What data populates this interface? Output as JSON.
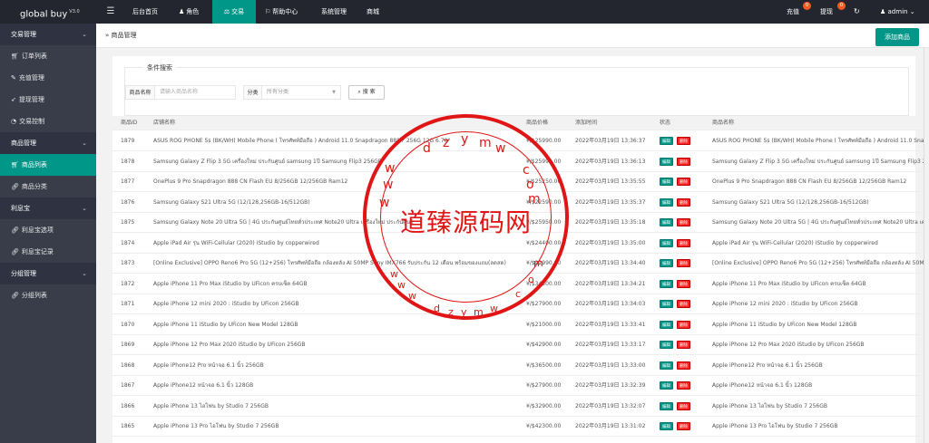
{
  "app": {
    "logo": "global buy",
    "version": "V3.0"
  },
  "topnav": {
    "items": [
      {
        "label": "后台首页",
        "icon": "home-icon"
      },
      {
        "label": "角色",
        "icon": "user-icon"
      },
      {
        "label": "交易",
        "icon": "scale-icon"
      },
      {
        "label": "帮助中心",
        "icon": "flag-icon"
      },
      {
        "label": "系统管理",
        "icon": ""
      },
      {
        "label": "商城",
        "icon": ""
      }
    ],
    "recharge_label": "充值",
    "recharge_count": "0",
    "withdraw_label": "提现",
    "withdraw_count": "0",
    "user": "admin"
  },
  "sidebar": {
    "groups": [
      {
        "label": "交易管理",
        "items": [
          {
            "label": "订单列表",
            "icon": "cart-icon"
          },
          {
            "label": "充值管理",
            "icon": "comment-icon"
          },
          {
            "label": "提现管理",
            "icon": "rocket-icon"
          },
          {
            "label": "交易控制",
            "icon": "dashboard-icon"
          }
        ]
      },
      {
        "label": "商品管理",
        "items": [
          {
            "label": "商品列表",
            "icon": "cart-icon"
          },
          {
            "label": "商品分类",
            "icon": "link-icon"
          }
        ]
      },
      {
        "label": "利息宝",
        "items": [
          {
            "label": "利息宝选项",
            "icon": "link-icon"
          },
          {
            "label": "利息宝记录",
            "icon": "link-icon"
          }
        ]
      },
      {
        "label": "分组管理",
        "items": [
          {
            "label": "分组列表",
            "icon": "link-icon"
          }
        ]
      }
    ]
  },
  "breadcrumb": "商品管理",
  "add_button": "添加商品",
  "filter": {
    "legend": "条件搜索",
    "name_label": "商品名称",
    "name_placeholder": "请输入商品名称",
    "category_label": "分类",
    "category_value": "所有分类",
    "search_button": "搜 索"
  },
  "table": {
    "headers": [
      "商品ID",
      "店铺名称",
      "商品价格",
      "添加时间",
      "状态",
      "商品名称"
    ],
    "edit_label": "编辑",
    "delete_label": "删除",
    "rows": [
      {
        "id": "1879",
        "name": "ASUS ROG PHONE 5s (BK/WH) Mobile Phone ( โทรศัพท์มือถือ ) Android 11.0 Snapdragon 888+ 256G 12G 6.78\"",
        "price": "¥/$25990.00",
        "time": "2022年03月19日 13:36:37"
      },
      {
        "id": "1878",
        "name": "Samsung Galaxy Z Flip 3 5G เครื่องใหม่ ประกันศูนย์ samsung 1ปี Samsung Flip3 256GB",
        "price": "¥/$25990.00",
        "time": "2022年03月19日 13:36:13"
      },
      {
        "id": "1877",
        "name": "OnePlus 9 Pro Snapdragon 888 CN Flash EU 8/256GB 12/256GB Ram12",
        "price": "¥/$25250.00",
        "time": "2022年03月19日 13:35:55"
      },
      {
        "id": "1876",
        "name": "Samsung Galaxy S21 Ultra 5G (12/128,256GB-16/512GB)",
        "price": "¥/$22590.00",
        "time": "2022年03月19日 13:35:37"
      },
      {
        "id": "1875",
        "name": "Samsung Galaxy Note 20 Ultra 5G | 4G ประกันศูนย์ไทยทั่วประเทศ Note20 Ultra เครื่องใหม่ ประกันศูนย์",
        "price": "¥/$25950.00",
        "time": "2022年03月19日 13:35:18"
      },
      {
        "id": "1874",
        "name": "Apple iPad Air รุ่น WiFi-Cellular (2020) iStudio by copperwired",
        "price": "¥/$24400.00",
        "time": "2022年03月19日 13:35:00"
      },
      {
        "id": "1873",
        "name": "[Online Exclusive] OPPO Reno6 Pro 5G (12+256) โทรศัพท์มือถือ กล้องหลัง AI 50MP Sony IMX766 รับประกัน 12 เดือน พร้อมของแถม(ลดสด)",
        "price": "¥/$22990.00",
        "time": "2022年03月19日 13:34:40"
      },
      {
        "id": "1872",
        "name": "Apple iPhone 11 Pro Max iStudio by UFicon ครบเซ็ต 64GB",
        "price": "¥/$34500.00",
        "time": "2022年03月19日 13:34:21"
      },
      {
        "id": "1871",
        "name": "Apple iPhone 12 mini 2020 : iStudio by UFicon 256GB",
        "price": "¥/$27900.00",
        "time": "2022年03月19日 13:34:03"
      },
      {
        "id": "1870",
        "name": "Apple iPhone 11 iStudio by UFicon New Model 128GB",
        "price": "¥/$21000.00",
        "time": "2022年03月19日 13:33:41"
      },
      {
        "id": "1869",
        "name": "Apple iPhone 12 Pro Max 2020 iStudio by UFicon 256GB",
        "price": "¥/$42900.00",
        "time": "2022年03月19日 13:33:17"
      },
      {
        "id": "1868",
        "name": "Apple iPhone12 Pro หน้าจอ 6.1 นิ้ว 256GB",
        "price": "¥/$36500.00",
        "time": "2022年03月19日 13:33:00"
      },
      {
        "id": "1867",
        "name": "Apple iPhone12 หน้าจอ 6.1 นิ้ว 128GB",
        "price": "¥/$27900.00",
        "time": "2022年03月19日 13:32:39"
      },
      {
        "id": "1866",
        "name": "Apple iPhone 13 ไอโฟน by Studio 7 256GB",
        "price": "¥/$32900.00",
        "time": "2022年03月19日 13:32:07"
      },
      {
        "id": "1865",
        "name": "Apple iPhone 13 Pro ไอโฟน by Studio 7 256GB",
        "price": "¥/$42300.00",
        "time": "2022年03月19日 13:31:02"
      }
    ]
  },
  "watermark": {
    "text": "道臻源码网",
    "url": "www.dzym.com",
    "color": "#e01515"
  }
}
